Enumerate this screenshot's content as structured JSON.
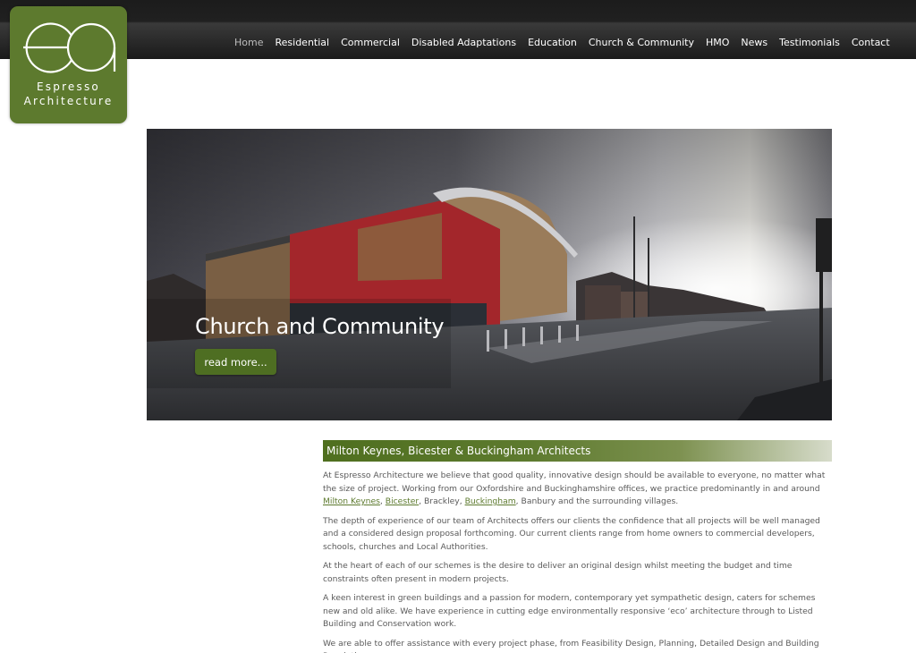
{
  "brand": {
    "name_line1": "Espresso",
    "name_line2": "Architecture",
    "color": "#5d7a2e"
  },
  "nav": {
    "items": [
      {
        "label": "Home",
        "active": true
      },
      {
        "label": "Residential"
      },
      {
        "label": "Commercial"
      },
      {
        "label": "Disabled Adaptations"
      },
      {
        "label": "Education"
      },
      {
        "label": "Church & Community"
      },
      {
        "label": "HMO"
      },
      {
        "label": "News"
      },
      {
        "label": "Testimonials"
      },
      {
        "label": "Contact"
      }
    ]
  },
  "hero": {
    "title": "Church and Community",
    "button_label": "read more..."
  },
  "main": {
    "heading": "Milton Keynes, Bicester & Buckingham Architects",
    "p1_a": "At Espresso Architecture we believe that good quality, innovative design should be available to everyone, no matter what the size of project. Working from our Oxfordshire and Buckinghamshire offices, we practice predominantly in and around ",
    "link_mk": "Milton Keynes",
    "p1_b": ", ",
    "link_bicester": "Bicester",
    "p1_c": ", Brackley, ",
    "link_buckingham": "Buckingham",
    "p1_d": ", Banbury and the surrounding villages.",
    "p2": "The depth of experience of our team of Architects offers our clients the confidence that all projects will be well managed and a considered design proposal forthcoming. Our current clients range from home owners to commercial developers, schools, churches and Local Authorities.",
    "p3": "At the heart of each of our schemes is the desire to deliver an original design whilst meeting the budget and time constraints often present in modern projects.",
    "p4": "A keen interest in green buildings and a passion for modern, contemporary yet sympathetic design, caters for schemes new and old alike. We have experience in cutting edge environmentally responsive ‘eco’ architecture through to Listed Building and Conservation work.",
    "p5": "We are able to offer assistance with every project phase, from Feasibility Design, Planning, Detailed Design and Building Regulations"
  }
}
